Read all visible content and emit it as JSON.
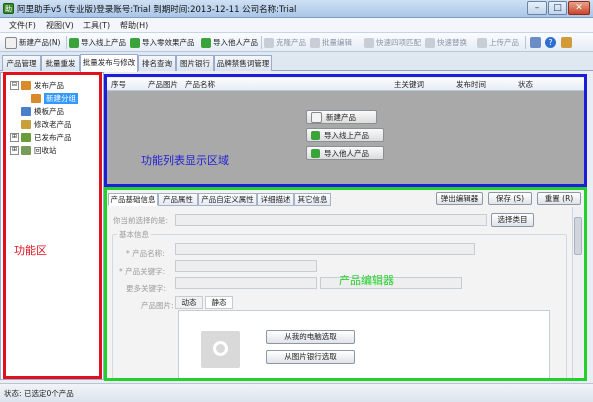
{
  "window": {
    "title": "阿里助手v5 (专业版)登录账号:Trial  到期时间:2013-12-11  公司名称:Trial"
  },
  "menu": [
    "文件(F)",
    "视图(V)",
    "工具(T)",
    "帮助(H)"
  ],
  "toolbar": [
    {
      "label": "新建产品(N)",
      "icon": "new-product-icon",
      "disabled": false
    },
    {
      "label": "导入线上产品",
      "icon": "import-online-icon",
      "disabled": false
    },
    {
      "label": "导入零效果产品",
      "icon": "import-zero-icon",
      "disabled": false
    },
    {
      "label": "导入他人产品",
      "icon": "import-others-icon",
      "disabled": false
    },
    {
      "label": "克隆产品",
      "icon": "clone-icon",
      "disabled": true
    },
    {
      "label": "批量编辑",
      "icon": "batch-edit-icon",
      "disabled": true
    },
    {
      "label": "快速四项匹配",
      "icon": "quick-match-icon",
      "disabled": true
    },
    {
      "label": "快速替换",
      "icon": "quick-replace-icon",
      "disabled": true
    },
    {
      "label": "上传产品",
      "icon": "upload-icon",
      "disabled": true
    }
  ],
  "tabs": [
    "产品管理",
    "批量重发",
    "批量发布与修改",
    "排名查询",
    "图片银行",
    "品牌禁售词管理"
  ],
  "active_tab": 2,
  "tree": [
    {
      "label": "发布产品",
      "expander": "⊟",
      "icon": "folder-icon"
    },
    {
      "label": "新建分组",
      "expander": "",
      "icon": "folder-icon",
      "selected": true
    },
    {
      "label": "模板产品",
      "expander": "",
      "icon": "template-icon"
    },
    {
      "label": "修改老产品",
      "expander": "",
      "icon": "modify-icon"
    },
    {
      "label": "已发布产品",
      "expander": "⊞",
      "icon": "published-icon"
    },
    {
      "label": "回收站",
      "expander": "⊞",
      "icon": "recycle-icon"
    }
  ],
  "list": {
    "columns": [
      "序号",
      "产品图片",
      "产品名称",
      "主关键词",
      "发布时间",
      "状态"
    ],
    "actions": [
      {
        "label": "新建产品",
        "icon": "new-product-icon"
      },
      {
        "label": "导入线上产品",
        "icon": "import-online-icon"
      },
      {
        "label": "导入他人产品",
        "icon": "import-others-icon"
      }
    ]
  },
  "editor": {
    "tabs": [
      "产品基础信息",
      "产品属性",
      "产品自定义属性",
      "详细描述",
      "其它信息"
    ],
    "popout_label": "弹出编辑器",
    "save_label": "保存 (S)",
    "reset_label": "重置 (R)",
    "category_label": "你当前选择的是:",
    "select_category_label": "选择类目",
    "basic_info_label": "基本信息",
    "name_label": "* 产品名称:",
    "keyword_label": "* 产品关键字:",
    "more_keywords_label": "更多关键字:",
    "image_label": "产品图片:",
    "image_tabs": [
      "动态",
      "静态"
    ],
    "from_pc_label": "从我的电脑选取",
    "from_bank_label": "从图片银行选取"
  },
  "annotations": {
    "left": "功能区",
    "top": "功能列表显示区域",
    "bottom": "产品编辑器"
  },
  "colors": {
    "left_box": "#e0101e",
    "top_box": "#1e1ed8",
    "bottom_box": "#22d22a"
  },
  "status": {
    "label": "状态:",
    "text": "已选定0个产品"
  }
}
